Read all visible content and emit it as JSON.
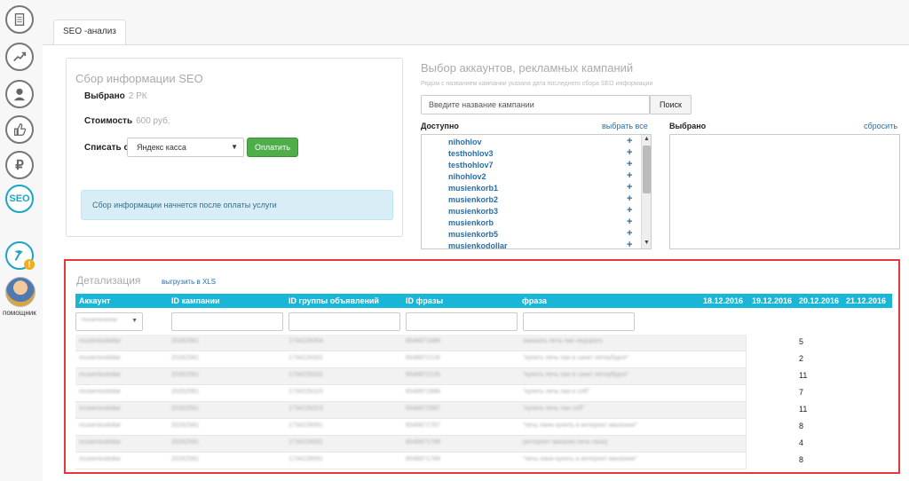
{
  "sidebar": {
    "icons": [
      "documents-icon",
      "chart-icon",
      "user-icon",
      "like-icon",
      "ruble-icon",
      "seo-icon",
      "hammer-icon",
      "helper-avatar"
    ],
    "seo_label": "SEO",
    "helper_label": "помощник"
  },
  "tab": {
    "label": "SEO -анализ"
  },
  "seo_collect": {
    "title": "Сбор информации SEO",
    "selected_label": "Выбрано",
    "selected_value": "2 РК",
    "cost_label": "Стоимость",
    "cost_value": "600 руб.",
    "debit_label": "Списать с",
    "payment_select": "Яндекс касса",
    "pay_button": "Оплатить",
    "info": "Сбор информации начнется после оплаты услуги"
  },
  "accounts": {
    "title": "Выбор аккаунтов, рекламных кампаний",
    "subtitle": "Рядом с названием кампании указана дата последнего сбора SEO информации",
    "search_placeholder": "Введите название кампании",
    "search_button": "Поиск",
    "available_label": "Доступно",
    "select_all": "выбрать все",
    "selected_label": "Выбрано",
    "reset": "сбросить",
    "items": [
      "nihohlov",
      "testhohlov3",
      "testhohlov7",
      "nihohlov2",
      "musienkorb1",
      "musienkorb2",
      "musienkorb3",
      "musienkorb",
      "musienkorb5",
      "musienkodollar"
    ]
  },
  "details": {
    "title": "Детализация",
    "export": "выгрузить в XLS",
    "columns": [
      "Аккаунт",
      "ID кампании",
      "ID группы объявлений",
      "ID фразы",
      "фраза",
      "18.12.2016",
      "19.12.2016",
      "20.12.2016",
      "21.12.2016"
    ],
    "account_filter": "musienkodollar",
    "rows": [
      {
        "account": "musienkodollar",
        "campaign": "20262581",
        "group": "1734226454",
        "phrase_id": "6548871688",
        "phrase": "заказать печь пан недорого",
        "value": "5"
      },
      {
        "account": "musienkodollar",
        "campaign": "20262581",
        "group": "1734226332",
        "phrase_id": "6548872126",
        "phrase": "\"купить печь пан в санкт петербурге\"",
        "value": "2"
      },
      {
        "account": "musienkodollar",
        "campaign": "20262581",
        "group": "1734226332",
        "phrase_id": "6548872126",
        "phrase": "\"купить печь пан в санкт петербурге\"",
        "value": "11"
      },
      {
        "account": "musienkodollar",
        "campaign": "20262581",
        "group": "1734226315",
        "phrase_id": "6548872986",
        "phrase": "\"купить печь пан в спб\"",
        "value": "7"
      },
      {
        "account": "musienkodollar",
        "campaign": "20262581",
        "group": "1734226315",
        "phrase_id": "6548872987",
        "phrase": "\"купить печь пан спб\"",
        "value": "11"
      },
      {
        "account": "musienkodollar",
        "campaign": "20262581",
        "group": "1734226091",
        "phrase_id": "6548871787",
        "phrase": "\"печь пани купить в интернет магазине\"",
        "value": "8"
      },
      {
        "account": "musienkodollar",
        "campaign": "20262581",
        "group": "1734226091",
        "phrase_id": "6548871788",
        "phrase": "[интернет магазин печь пани]",
        "value": "4"
      },
      {
        "account": "musienkodollar",
        "campaign": "20262581",
        "group": "1734226091",
        "phrase_id": "6548871789",
        "phrase": "\"печь пани купить в интернет магазине\"",
        "value": "8"
      }
    ]
  }
}
